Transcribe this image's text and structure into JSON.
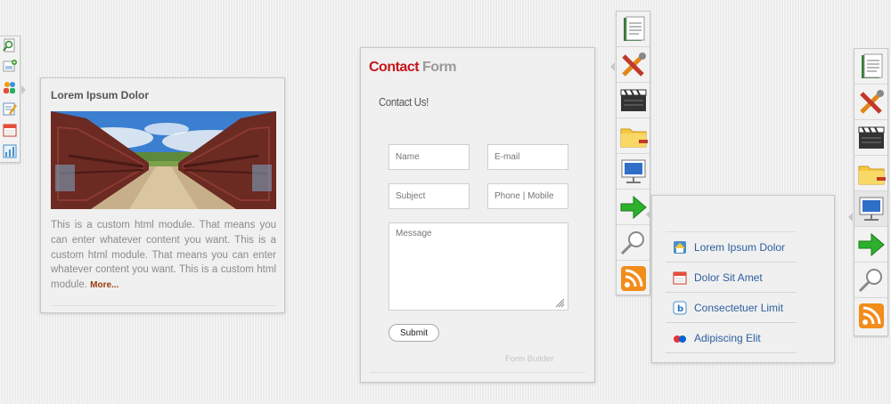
{
  "left_toolbar": {
    "icons": [
      "search-document-icon",
      "add-image-icon",
      "users-icon",
      "edit-form-icon",
      "calendar-icon",
      "chart-icon"
    ]
  },
  "custom_module": {
    "title": "Lorem Ipsum Dolor",
    "body": "This is a custom html module. That means you can enter whatever content you want. This is a custom html module. That means you can enter whatever content you want. This is a custom html module.",
    "more_link": "More..."
  },
  "contact_form": {
    "title_primary": "Contact",
    "title_secondary": "Form",
    "subtitle": "Contact Us!",
    "name_placeholder": "Name",
    "email_placeholder": "E-mail",
    "subject_placeholder": "Subject",
    "phone_placeholder": "Phone | Mobile",
    "message_placeholder": "Message",
    "submit_label": "Submit",
    "footer": "Form Builder"
  },
  "icon_tower": {
    "icons": [
      "document-icon",
      "tools-icon",
      "clapperboard-icon",
      "folder-icon",
      "monitor-icon",
      "green-arrow-icon",
      "magnifier-icon",
      "rss-icon"
    ]
  },
  "dropdown_menu": {
    "items": [
      {
        "label": "Lorem Ipsum Dolor",
        "icon": "home-icon"
      },
      {
        "label": "Dolor Sit Amet",
        "icon": "calendar-icon"
      },
      {
        "label": "Consectetuer Limit",
        "icon": "blogger-icon"
      },
      {
        "label": "Adipiscing Elit",
        "icon": "ebay-icon"
      }
    ]
  },
  "colors": {
    "accent_red": "#c4161c",
    "link_blue": "#2b5f9e",
    "more_link": "#9a3a10",
    "background": "#ececec"
  }
}
